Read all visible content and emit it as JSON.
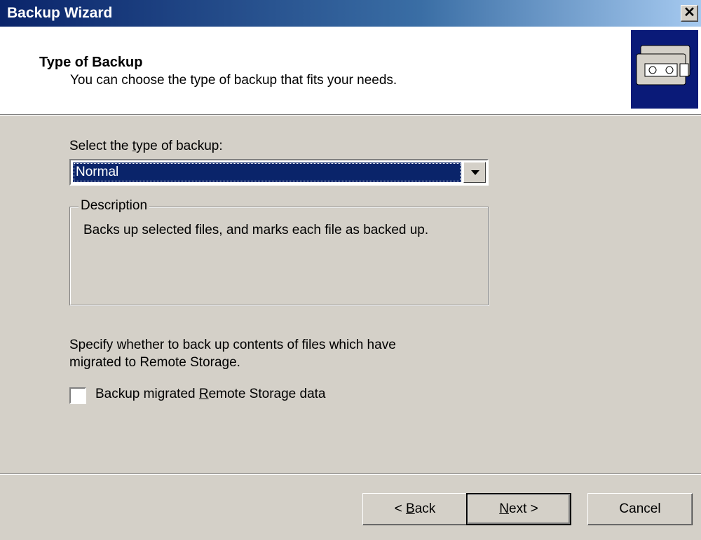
{
  "window": {
    "title": "Backup Wizard",
    "close_glyph": "✕"
  },
  "header": {
    "title": "Type of Backup",
    "subtitle": "You can choose the type of backup that fits your needs.",
    "icon": "backup-tapes-icon"
  },
  "backup_type": {
    "label_pre": "Select the ",
    "label_u": "t",
    "label_post": "ype of backup:",
    "selected": "Normal"
  },
  "description": {
    "legend": "Description",
    "text": "Backs up selected files, and marks each file as backed up."
  },
  "remote_storage": {
    "line1": "Specify whether to back up contents of files which have",
    "line2": "migrated to Remote Storage.",
    "checkbox_pre": "Backup migrated ",
    "checkbox_u": "R",
    "checkbox_post": "emote Storage data",
    "checked": false
  },
  "buttons": {
    "back_pre": "< ",
    "back_u": "B",
    "back_post": "ack",
    "next_u": "N",
    "next_post": "ext >",
    "cancel": "Cancel"
  },
  "colors": {
    "title_bar": "#0a246a",
    "face": "#d4d0c8",
    "highlight": "#0a246a"
  }
}
